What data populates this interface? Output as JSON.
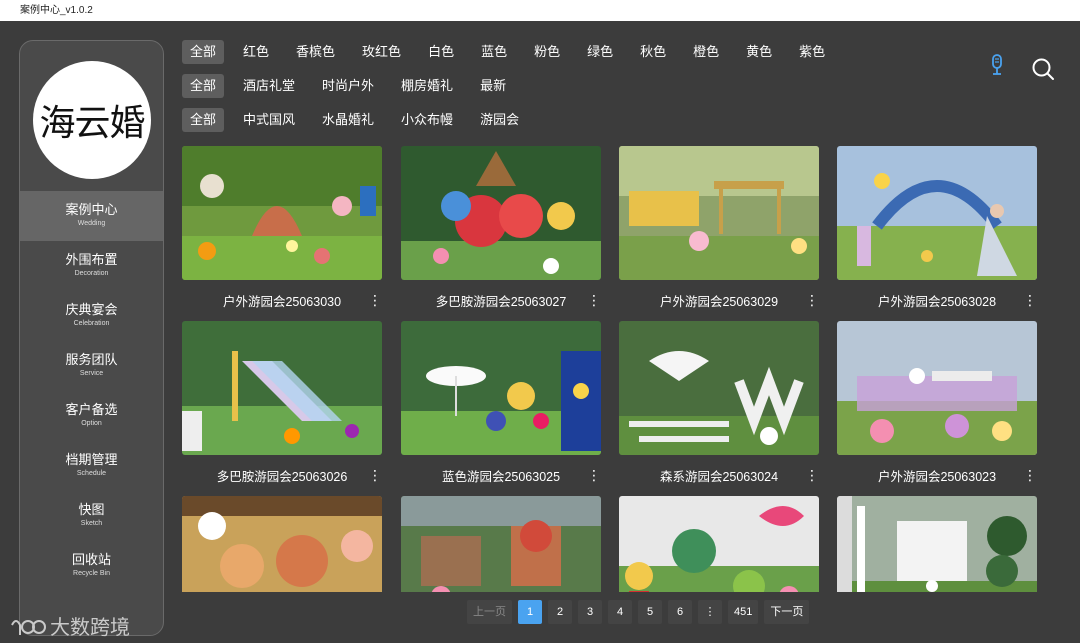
{
  "window": {
    "title": "案例中心_v1.0.2"
  },
  "logo": {
    "text": "海云婚"
  },
  "sidebar": {
    "items": [
      {
        "zh": "案例中心",
        "en": "Wedding",
        "active": true
      },
      {
        "zh": "外围布置",
        "en": "Decoration"
      },
      {
        "zh": "庆典宴会",
        "en": "Celebration"
      },
      {
        "zh": "服务团队",
        "en": "Service"
      },
      {
        "zh": "客户备选",
        "en": "Option"
      },
      {
        "zh": "档期管理",
        "en": "Schedule"
      },
      {
        "zh": "快图",
        "en": "Sketch"
      },
      {
        "zh": "回收站",
        "en": "Recycle Bin"
      }
    ]
  },
  "filters": {
    "colors": [
      "全部",
      "红色",
      "香槟色",
      "玫红色",
      "白色",
      "蓝色",
      "粉色",
      "绿色",
      "秋色",
      "橙色",
      "黄色",
      "紫色"
    ],
    "venues": [
      "全部",
      "酒店礼堂",
      "时尚户外",
      "棚房婚礼",
      "最新"
    ],
    "styles": [
      "全部",
      "中式国风",
      "水晶婚礼",
      "小众布幔",
      "游园会"
    ]
  },
  "icons": {
    "mic": "microphone-icon",
    "search": "search-icon",
    "more": "more-vertical-icon"
  },
  "colors": {
    "accent": "#4aa3f0",
    "mic": "#4aa3f0"
  },
  "cards": [
    {
      "title": "户外游园会25063030"
    },
    {
      "title": "多巴胺游园会25063027"
    },
    {
      "title": "户外游园会25063029"
    },
    {
      "title": "户外游园会25063028"
    },
    {
      "title": "多巴胺游园会25063026"
    },
    {
      "title": "蓝色游园会25063025"
    },
    {
      "title": "森系游园会25063024"
    },
    {
      "title": "户外游园会25063023"
    },
    {
      "title": ""
    },
    {
      "title": ""
    },
    {
      "title": ""
    },
    {
      "title": ""
    }
  ],
  "pagination": {
    "prev": "上一页",
    "pages": [
      "1",
      "2",
      "3",
      "4",
      "5",
      "6"
    ],
    "current": "1",
    "ellipsis": "⋮",
    "last": "451",
    "next": "下一页"
  },
  "watermark": {
    "text": "大数跨境"
  }
}
